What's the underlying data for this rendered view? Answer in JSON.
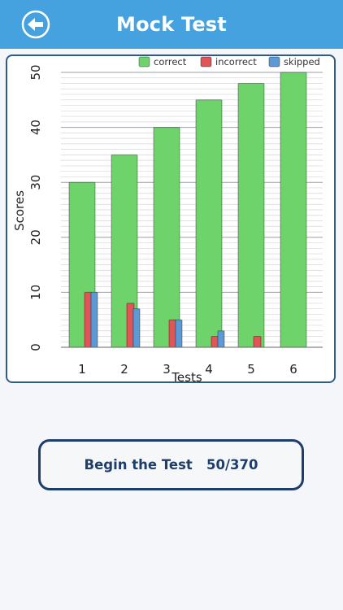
{
  "header": {
    "title": "Mock Test",
    "back_icon": "arrow-left-icon"
  },
  "colors": {
    "header_bg": "#45a2df",
    "correct": "#6fd36b",
    "incorrect": "#e05555",
    "skipped": "#5c9ad6",
    "button_border": "#1d3d6b"
  },
  "chart_data": {
    "type": "bar",
    "xlabel": "Tests",
    "ylabel": "Scores",
    "ylim": [
      0,
      50
    ],
    "yticks": [
      0,
      10,
      20,
      30,
      40,
      50
    ],
    "categories": [
      "1",
      "2",
      "3",
      "4",
      "5",
      "6"
    ],
    "series": [
      {
        "name": "correct",
        "values": [
          30,
          35,
          40,
          45,
          48,
          50
        ]
      },
      {
        "name": "incorrect",
        "values": [
          10,
          8,
          5,
          2,
          2,
          0
        ]
      },
      {
        "name": "skipped",
        "values": [
          10,
          7,
          5,
          3,
          0,
          0
        ]
      }
    ],
    "legend_position": "top-right",
    "grid": true
  },
  "begin_button": {
    "label": "Begin the Test",
    "progress": "50/370"
  }
}
